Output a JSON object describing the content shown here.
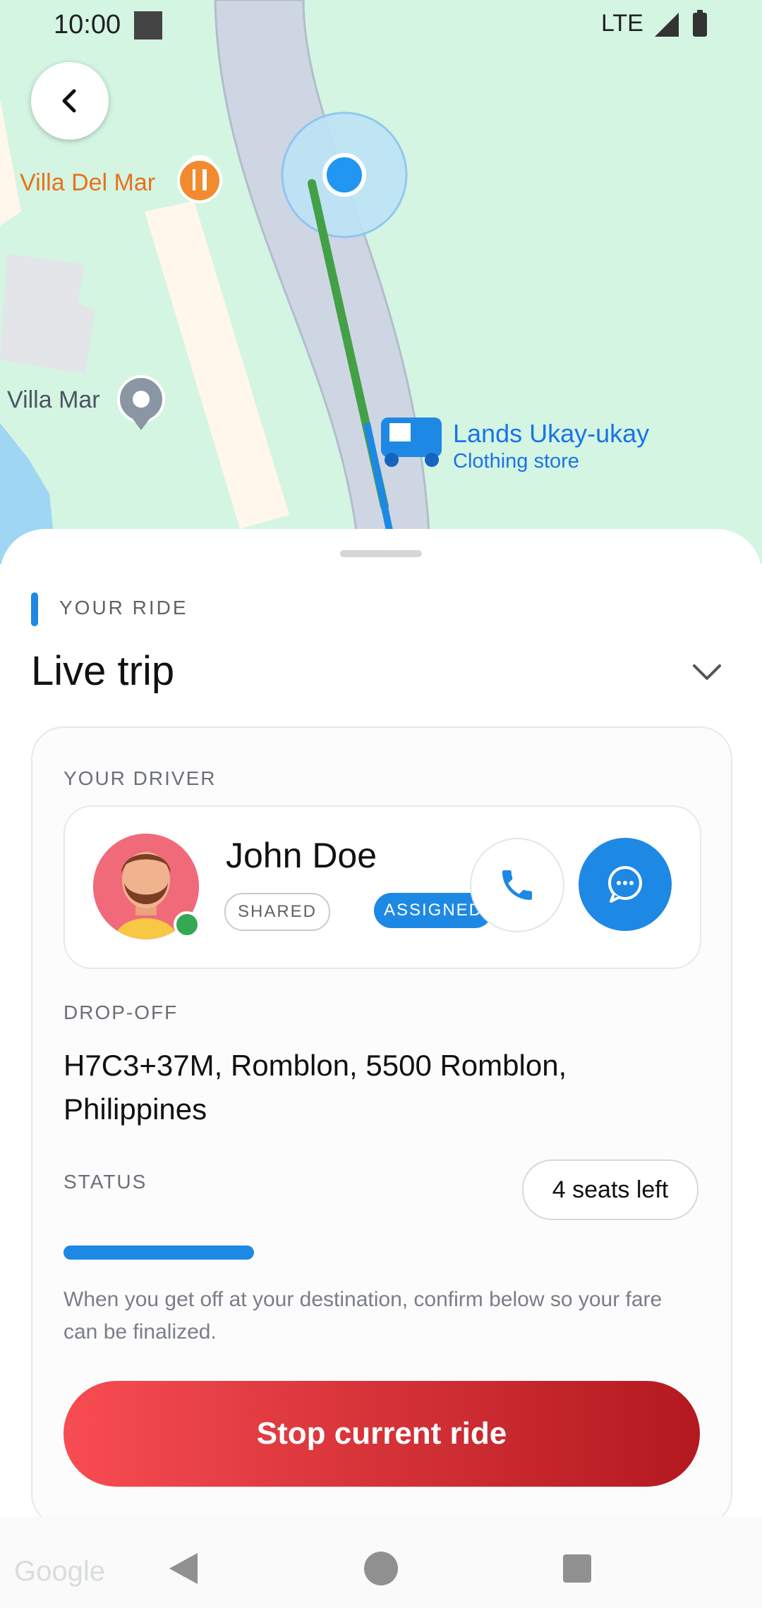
{
  "status_bar": {
    "time": "10:00",
    "network": "LTE"
  },
  "map": {
    "pois": {
      "villa_del_mar": "Villa Del Mar",
      "villa_mar": "Villa Mar",
      "lands_ukay": "Lands Ukay-ukay",
      "lands_ukay_sub": "Clothing store"
    }
  },
  "sheet": {
    "section_label": "YOUR RIDE",
    "title": "Live trip",
    "driver_label": "YOUR DRIVER",
    "driver": {
      "name": "John Doe",
      "chips": [
        "SHARED",
        "ASSIGNED"
      ],
      "online": true
    },
    "dropoff_label": "DROP-OFF",
    "dropoff_address": "H7C3+37M, Romblon, 5500 Romblon, Philippines",
    "status_label": "STATUS",
    "seats": "4 seats left",
    "progress_fraction": 0.3,
    "note": "When you get off at your destination, confirm below so your fare can be finalized.",
    "stop_button": "Stop current ride"
  },
  "colors": {
    "accent": "#1e88e5",
    "danger": "#e53935",
    "map_bg": "#d4f5e2"
  },
  "icons": [
    "back-arrow-icon",
    "restaurant-icon",
    "pin-icon",
    "tricycle-icon",
    "chevron-down-icon",
    "phone-icon",
    "chat-icon"
  ],
  "watermark": "Google"
}
